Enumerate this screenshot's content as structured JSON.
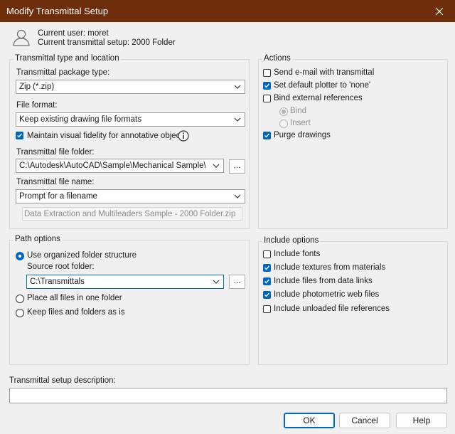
{
  "window": {
    "title": "Modify Transmittal Setup"
  },
  "user_info": {
    "current_user": "Current user: moret",
    "current_setup": "Current transmittal setup: 2000 Folder"
  },
  "type_location": {
    "legend": "Transmittal type and location",
    "package_type_label": "Transmittal package type:",
    "package_type_value": "Zip (*.zip)",
    "file_format_label": "File format:",
    "file_format_value": "Keep existing drawing file formats",
    "maintain_fidelity_label": "Maintain visual fidelity for annotative objects",
    "file_folder_label": "Transmittal file folder:",
    "file_folder_value": "C:\\Autodesk\\AutoCAD\\Sample\\Mechanical Sample\\",
    "browse_label": "...",
    "file_name_label": "Transmittal file name:",
    "file_name_value": "Prompt for a filename",
    "file_name_preview": "Data Extraction and Multileaders Sample - 2000 Folder.zip"
  },
  "actions": {
    "legend": "Actions",
    "send_email": "Send e-mail with transmittal",
    "default_plotter": "Set default plotter to 'none'",
    "bind_xrefs": "Bind external references",
    "bind": "Bind",
    "insert": "Insert",
    "purge": "Purge drawings"
  },
  "path_options": {
    "legend": "Path options",
    "organized": "Use organized folder structure",
    "source_root_label": "Source root folder:",
    "source_root_value": "C:\\Transmittals",
    "browse_label": "...",
    "one_folder": "Place all files in one folder",
    "keep_as_is": "Keep files and folders as is"
  },
  "include_options": {
    "legend": "Include options",
    "fonts": "Include fonts",
    "textures": "Include textures from materials",
    "data_links": "Include files from data links",
    "photometric": "Include photometric web files",
    "unloaded": "Include unloaded file references"
  },
  "description": {
    "label": "Transmittal setup description:",
    "value": ""
  },
  "buttons": {
    "ok": "OK",
    "cancel": "Cancel",
    "help": "Help"
  },
  "colors": {
    "titlebar": "#6e2e0c",
    "accent": "#0067c0",
    "background": "#f0f0f0"
  },
  "icons": {
    "user": "user-icon",
    "info": "info-icon",
    "close": "close-icon",
    "dropdown": "chevron-down-icon"
  }
}
